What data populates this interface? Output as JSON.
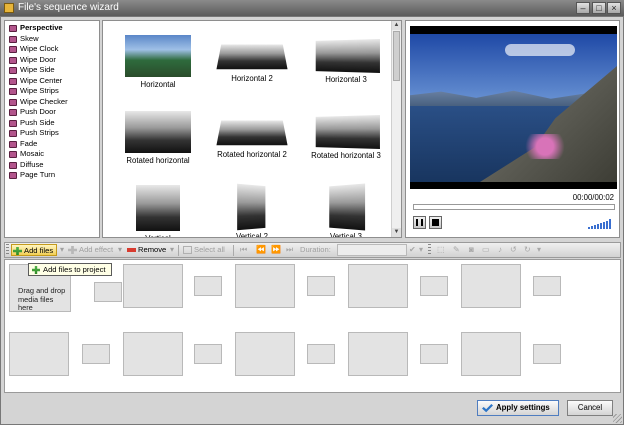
{
  "window": {
    "title": "File's sequence wizard"
  },
  "effects": [
    "Perspective",
    "Skew",
    "Wipe Clock",
    "Wipe Door",
    "Wipe Side",
    "Wipe Center",
    "Wipe Strips",
    "Wipe Checker",
    "Push Door",
    "Push Side",
    "Push Strips",
    "Fade",
    "Mosaic",
    "Diffuse",
    "Page Turn"
  ],
  "selected_effect": "Perspective",
  "transitions": [
    {
      "label": "Horizontal"
    },
    {
      "label": "Horizontal 2"
    },
    {
      "label": "Horizontal 3"
    },
    {
      "label": "Rotated horizontal"
    },
    {
      "label": "Rotated horizontal 2"
    },
    {
      "label": "Rotated horizontal 3"
    },
    {
      "label": "Vertical"
    },
    {
      "label": "Vertical 2"
    },
    {
      "label": "Vertical 3"
    }
  ],
  "preview": {
    "timecode": "00:00/00:02",
    "volume_icon": "volume-bars-icon"
  },
  "toolbar": {
    "add_files": "Add files",
    "add_effect": "Add effect",
    "remove": "Remove",
    "select_all": "Select all",
    "duration_label": "Duration:",
    "duration_value": ""
  },
  "timeline": {
    "dropzone_text_line1": "Drag and drop",
    "dropzone_text_line2": "media files here",
    "tooltip": "Add files to project"
  },
  "buttons": {
    "apply": "Apply settings",
    "cancel": "Cancel"
  },
  "colors": {
    "accent": "#2b74c7",
    "effect_icon": "#b2558c",
    "add_files_bg": "#f2cf55"
  }
}
